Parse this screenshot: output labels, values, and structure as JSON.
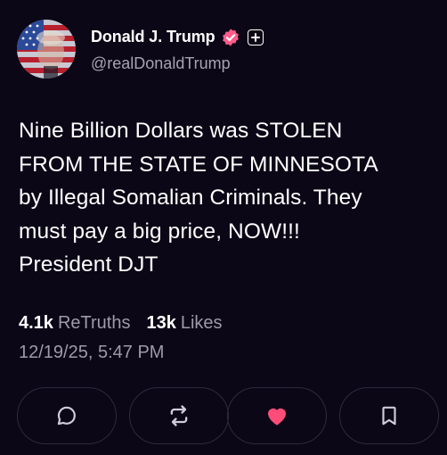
{
  "author": {
    "display_name": "Donald J. Trump",
    "handle": "@realDonaldTrump",
    "verified_color": "#ff5c8a"
  },
  "post": {
    "text": "Nine Billion Dollars was STOLEN\nFROM THE STATE OF MINNESOTA\nby Illegal Somalian Criminals. They\nmust pay a big price, NOW!!!\nPresident DJT"
  },
  "stats": {
    "retruths_count": "4.1k",
    "retruths_label": "ReTruths",
    "likes_count": "13k",
    "likes_label": "Likes"
  },
  "timestamp": "12/19/25, 5:47 PM",
  "actions": [
    {
      "name": "reply",
      "icon": "comment-icon"
    },
    {
      "name": "retruth",
      "icon": "repost-icon"
    },
    {
      "name": "like",
      "icon": "heart-icon",
      "active": true,
      "color": "#ff4d7a"
    },
    {
      "name": "bookmark",
      "icon": "bookmark-icon"
    }
  ]
}
